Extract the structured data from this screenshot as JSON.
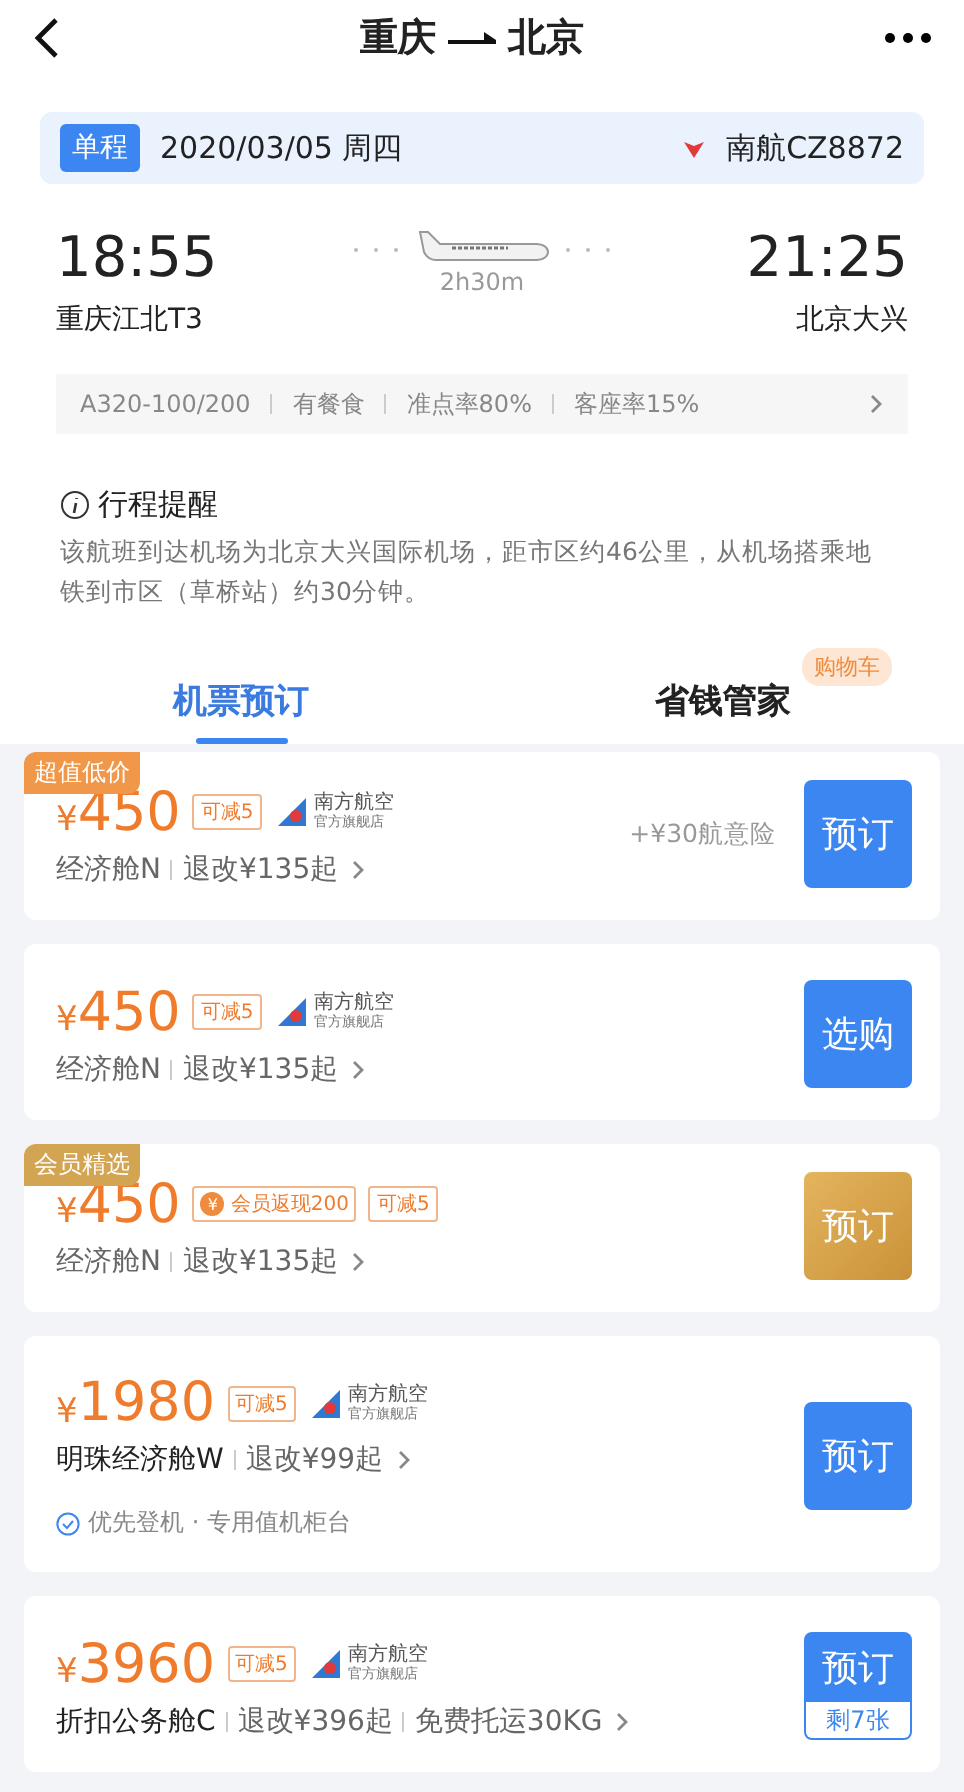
{
  "header": {
    "from": "重庆",
    "to": "北京"
  },
  "flight": {
    "trip_type": "单程",
    "date": "2020/03/05 周四",
    "flight_no": "南航CZ8872",
    "depart_time": "18:55",
    "depart_airport": "重庆江北T3",
    "duration": "2h30m",
    "arrive_time": "21:25",
    "arrive_airport": "北京大兴",
    "facts": [
      "A320-100/200",
      "有餐食",
      "准点率80%",
      "客座率15%"
    ]
  },
  "reminder": {
    "title": "行程提醒",
    "text": "该航班到达机场为北京大兴国际机场，距市区约46公里，从机场搭乘地铁到市区（草桥站）约30分钟。"
  },
  "tabs": [
    {
      "label": "机票预订",
      "selected": true
    },
    {
      "label": "省钱管家",
      "selected": false,
      "badge": "购物车"
    }
  ],
  "offers": [
    {
      "tag": {
        "text": "超值低价",
        "kind": "deal"
      },
      "currency": "¥",
      "price": "450",
      "chips": [
        {
          "kind": "discount",
          "text": "可减5"
        }
      ],
      "airline": {
        "name": "南方航空",
        "sub": "官方旗舰店"
      },
      "extra": "+¥30航意险",
      "cabin": "经济舱N",
      "emphasized": false,
      "details": [
        "退改¥135起"
      ],
      "button": {
        "label": "预订",
        "kind": "primary"
      }
    },
    {
      "currency": "¥",
      "price": "450",
      "chips": [
        {
          "kind": "discount",
          "text": "可减5"
        }
      ],
      "airline": {
        "name": "南方航空",
        "sub": "官方旗舰店"
      },
      "cabin": "经济舱N",
      "emphasized": false,
      "details": [
        "退改¥135起"
      ],
      "button": {
        "label": "选购",
        "kind": "primary"
      }
    },
    {
      "tag": {
        "text": "会员精选",
        "kind": "member"
      },
      "currency": "¥",
      "price": "450",
      "chips": [
        {
          "kind": "cashback",
          "icon": "¥",
          "text": "会员返现200"
        },
        {
          "kind": "discount",
          "text": "可减5"
        }
      ],
      "cabin": "经济舱N",
      "emphasized": false,
      "details": [
        "退改¥135起"
      ],
      "button": {
        "label": "预订",
        "kind": "member"
      }
    },
    {
      "currency": "¥",
      "price": "1980",
      "chips": [
        {
          "kind": "discount",
          "text": "可减5"
        }
      ],
      "airline": {
        "name": "南方航空",
        "sub": "官方旗舰店"
      },
      "cabin": "明珠经济舱W",
      "emphasized": true,
      "details": [
        "退改¥99起"
      ],
      "perk": "优先登机 · 专用值机柜台",
      "button": {
        "label": "预订",
        "kind": "primary"
      }
    },
    {
      "currency": "¥",
      "price": "3960",
      "chips": [
        {
          "kind": "discount",
          "text": "可减5"
        }
      ],
      "airline": {
        "name": "南方航空",
        "sub": "官方旗舰店"
      },
      "cabin": "折扣公务舱C",
      "emphasized": true,
      "details": [
        "退改¥396起",
        "免费托运30KG"
      ],
      "button": {
        "label": "预订",
        "kind": "primary",
        "remaining": "剩7张"
      }
    }
  ]
}
